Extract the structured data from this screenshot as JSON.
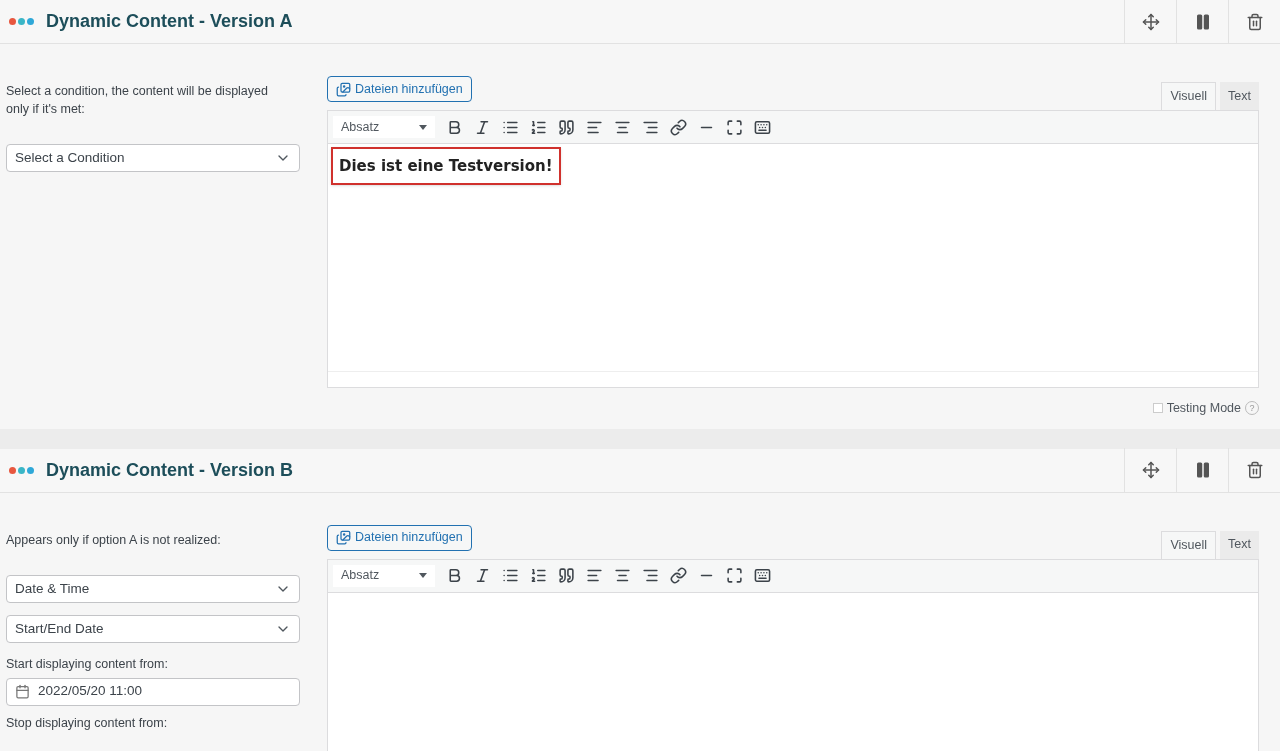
{
  "panels": [
    {
      "title": "Dynamic Content - Version A",
      "left": [
        {
          "kind": "text",
          "text": "Select a condition, the content will be displayed only if it's met:"
        },
        {
          "kind": "select",
          "value": "Select a Condition"
        }
      ],
      "editor": {
        "media_button": "Dateien hinzufügen",
        "tabs": [
          {
            "label": "Visuell",
            "selected": true
          },
          {
            "label": "Text",
            "selected": false
          }
        ],
        "format": "Absatz",
        "content": "Dies ist eine Testversion!",
        "highlighted": true
      },
      "testing_mode": {
        "label": "Testing Mode",
        "checked": false,
        "help": "?"
      }
    },
    {
      "title": "Dynamic Content - Version B",
      "left": [
        {
          "kind": "text",
          "text": "Appears only if option A is not realized:"
        },
        {
          "kind": "select",
          "value": "Date & Time"
        },
        {
          "kind": "select",
          "value": "Start/End Date"
        },
        {
          "kind": "label",
          "text": "Start displaying content from:"
        },
        {
          "kind": "date",
          "value": "2022/05/20 11:00"
        },
        {
          "kind": "label",
          "text": "Stop displaying content from:"
        }
      ],
      "editor": {
        "media_button": "Dateien hinzufügen",
        "tabs": [
          {
            "label": "Visuell",
            "selected": true
          },
          {
            "label": "Text",
            "selected": false
          }
        ],
        "format": "Absatz"
      }
    }
  ]
}
